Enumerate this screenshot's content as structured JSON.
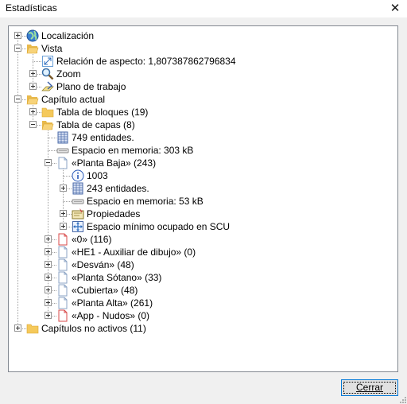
{
  "window": {
    "title": "Estadísticas",
    "close_glyph": "✕"
  },
  "tree": {
    "items": [
      {
        "label": "Localización",
        "icon": "globe-icon",
        "expander": "plus"
      },
      {
        "label": "Vista",
        "icon": "folder-open-icon",
        "expander": "minus"
      },
      {
        "label": "Relación de aspecto: 1,807387862796834",
        "icon": "aspect-ratio-icon",
        "expander": "none"
      },
      {
        "label": "Zoom",
        "icon": "magnifier-icon",
        "expander": "plus"
      },
      {
        "label": "Plano de trabajo",
        "icon": "work-plane-icon",
        "expander": "plus"
      },
      {
        "label": "Capítulo actual",
        "icon": "folder-open-icon",
        "expander": "minus"
      },
      {
        "label": "Tabla de bloques (19)",
        "icon": "folder-icon",
        "expander": "plus"
      },
      {
        "label": "Tabla de capas (8)",
        "icon": "folder-open-icon",
        "expander": "minus"
      },
      {
        "label": "749 entidades.",
        "icon": "table-icon",
        "expander": "none"
      },
      {
        "label": "Espacio en memoria: 303 kB",
        "icon": "memory-icon",
        "expander": "none"
      },
      {
        "label": "«Planta Baja» (243)",
        "icon": "page-icon",
        "expander": "minus"
      },
      {
        "label": "1003",
        "icon": "info-icon",
        "expander": "none"
      },
      {
        "label": "243 entidades.",
        "icon": "table-icon",
        "expander": "plus"
      },
      {
        "label": "Espacio en memoria: 53 kB",
        "icon": "memory-icon",
        "expander": "none"
      },
      {
        "label": "Propiedades",
        "icon": "properties-icon",
        "expander": "plus"
      },
      {
        "label": "Espacio mínimo ocupado en SCU",
        "icon": "move-icon",
        "expander": "plus"
      },
      {
        "label": "«0» (116)",
        "icon": "page-red-icon",
        "expander": "plus"
      },
      {
        "label": "«HE1 - Auxiliar de dibujo» (0)",
        "icon": "page-icon",
        "expander": "plus"
      },
      {
        "label": "«Desván» (48)",
        "icon": "page-icon",
        "expander": "plus"
      },
      {
        "label": "«Planta Sótano» (33)",
        "icon": "page-icon",
        "expander": "plus"
      },
      {
        "label": "«Cubierta» (48)",
        "icon": "page-icon",
        "expander": "plus"
      },
      {
        "label": "«Planta Alta» (261)",
        "icon": "page-icon",
        "expander": "plus"
      },
      {
        "label": "«App - Nudos» (0)",
        "icon": "page-red-icon",
        "expander": "plus"
      },
      {
        "label": "Capítulos no activos (11)",
        "icon": "folder-icon",
        "expander": "plus"
      }
    ]
  },
  "footer": {
    "close_button_label": "Cerrar"
  }
}
